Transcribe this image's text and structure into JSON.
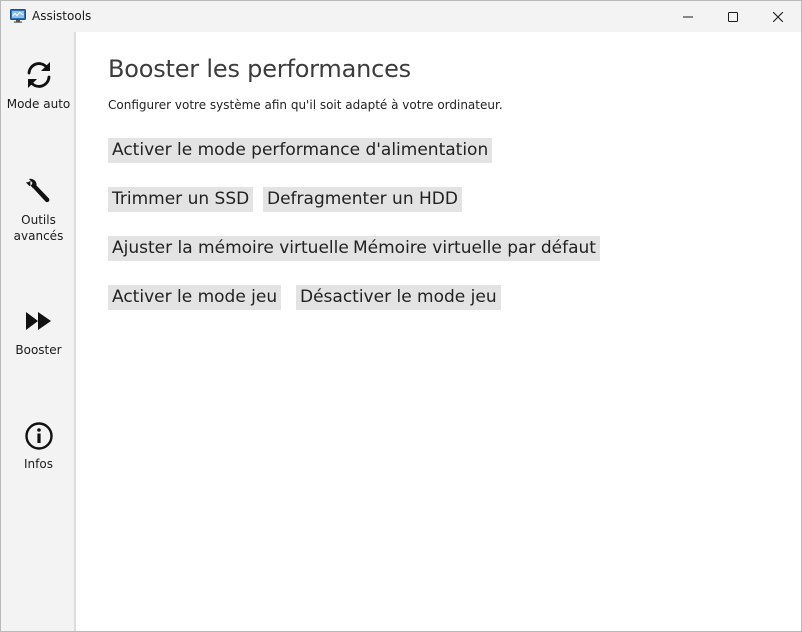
{
  "window": {
    "title": "Assistools"
  },
  "sidebar": {
    "items": [
      {
        "label": "Mode auto",
        "icon": "refresh-icon"
      },
      {
        "label": "Outils\navancés",
        "icon": "wrench-icon"
      },
      {
        "label": "Booster",
        "icon": "fast-forward-icon"
      },
      {
        "label": "Infos",
        "icon": "info-icon"
      }
    ]
  },
  "main": {
    "title": "Booster les performances",
    "subtitle": "Configurer votre système afin qu'il soit adapté à votre ordinateur.",
    "buttons": {
      "power_mode": "Activer le mode performance d'alimentation",
      "trim_ssd": "Trimmer un SSD",
      "defrag_hdd": "Defragmenter un HDD",
      "adjust_vmem": "Ajuster la mémoire virtuelle",
      "default_vmem": "Mémoire virtuelle par défaut",
      "enable_game": "Activer le mode jeu",
      "disable_game": "Désactiver le mode jeu"
    }
  },
  "colors": {
    "sidebar_bg": "#f3f3f3",
    "button_bg": "#e3e3e3",
    "title_color": "#3c3c3c"
  }
}
